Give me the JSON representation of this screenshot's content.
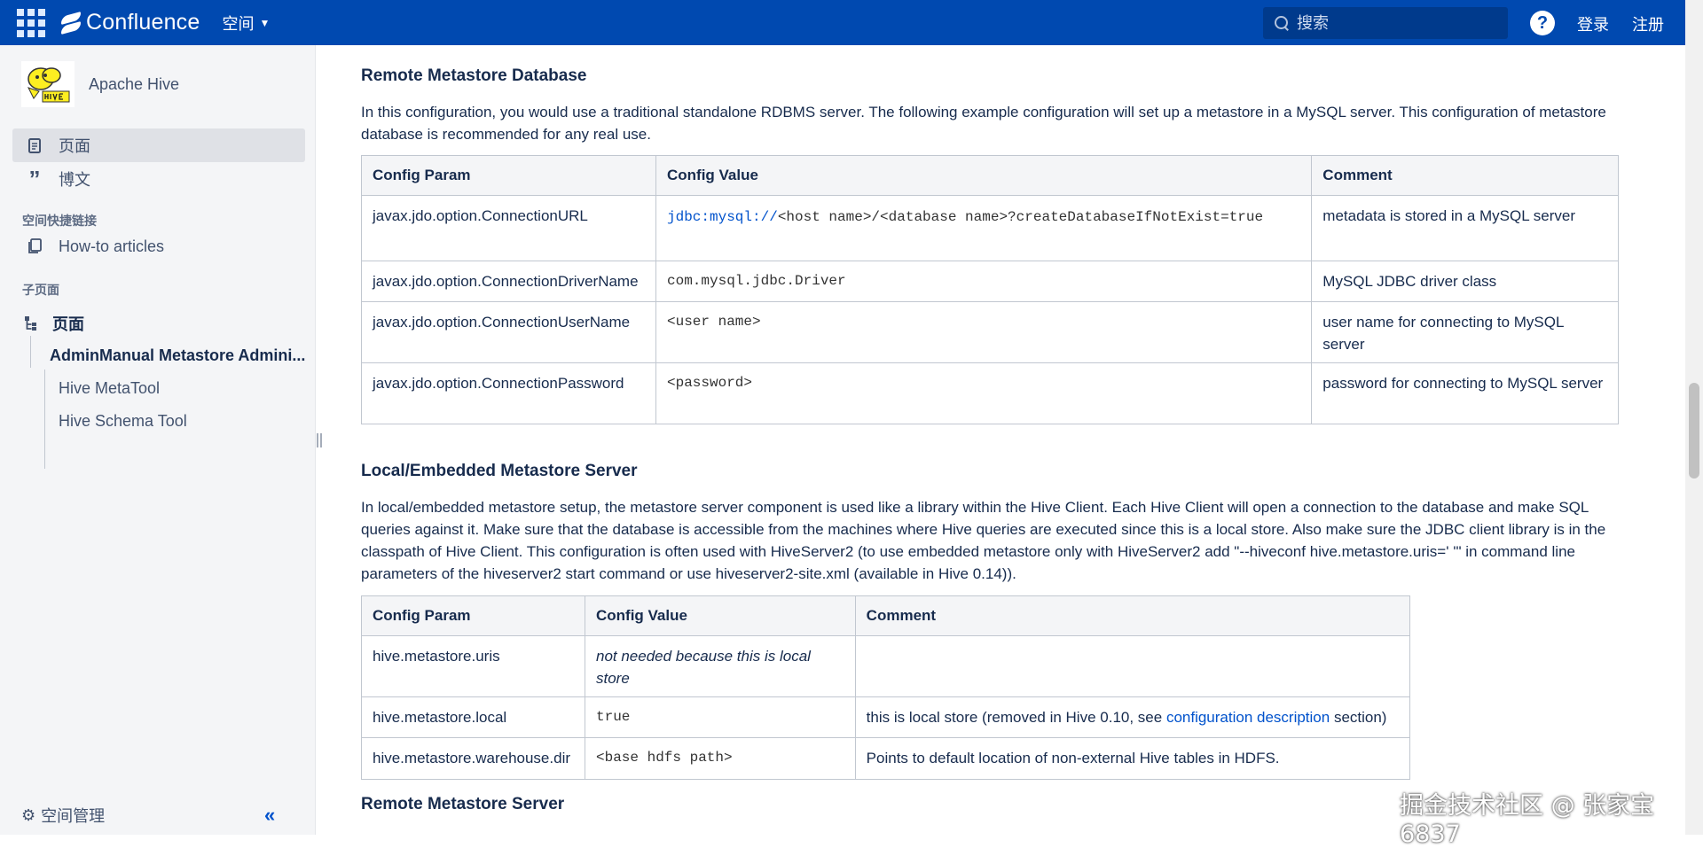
{
  "topbar": {
    "product": "Confluence",
    "space_menu": "空间",
    "search_placeholder": "搜索",
    "help": "?",
    "login": "登录",
    "signup": "注册",
    "brand_color": "#0049b0"
  },
  "sidebar": {
    "space_name": "Apache Hive",
    "nav": [
      {
        "label": "页面",
        "icon": "page-icon",
        "active": true
      },
      {
        "label": "博文",
        "icon": "quote-icon",
        "active": false
      }
    ],
    "shortcuts_title": "空间快捷链接",
    "shortcuts": [
      {
        "label": "How-to articles",
        "icon": "copy-icon"
      }
    ],
    "children_title": "子页面",
    "tree": {
      "root": "页面",
      "parent": "AdminManual Metastore Admini...",
      "children": [
        "Hive MetaTool",
        "Hive Schema Tool"
      ]
    },
    "footer": "空间管理",
    "collapse": "«"
  },
  "content": {
    "section1": {
      "heading": "Remote Metastore Database",
      "text": "In this configuration, you would use a traditional standalone RDBMS server. The following example configuration will set up a metastore in a MySQL server. This configuration of metastore database is recommended for any real use.",
      "table": {
        "headers": [
          "Config Param",
          "Config Value",
          "Comment"
        ],
        "rows": [
          {
            "param": "javax.jdo.option.ConnectionURL",
            "value_link": "jdbc:mysql://",
            "value_rest": "<host name>/<database name>?createDatabaseIfNotExist=true",
            "comment": "metadata is stored in a MySQL server"
          },
          {
            "param": "javax.jdo.option.ConnectionDriverName",
            "value": "com.mysql.jdbc.Driver",
            "comment": "MySQL JDBC driver class"
          },
          {
            "param": "javax.jdo.option.ConnectionUserName",
            "value": "<user name>",
            "comment": "user name for connecting to MySQL server"
          },
          {
            "param": "javax.jdo.option.ConnectionPassword",
            "value": "<password>",
            "comment": "password for connecting to MySQL server"
          }
        ]
      }
    },
    "section2": {
      "heading": "Local/Embedded Metastore Server",
      "text": "In local/embedded metastore setup, the metastore server component is used like a library within the Hive Client. Each Hive Client will open a connection to the database and make SQL queries against it. Make sure that the database is accessible from the machines where Hive queries are executed since this is a local store. Also make sure the JDBC client library is in the classpath of Hive Client. This configuration is often used with HiveServer2 (to use embedded metastore only with HiveServer2 add \"--hiveconf hive.metastore.uris=' '\" in command line parameters of the hiveserver2 start command or use hiveserver2-site.xml (available in Hive 0.14)).",
      "table": {
        "headers": [
          "Config Param",
          "Config Value",
          "Comment"
        ],
        "rows": [
          {
            "param": "hive.metastore.uris",
            "value": "not needed because this is local store",
            "comment": ""
          },
          {
            "param": "hive.metastore.local",
            "value": "true",
            "comment_pre": "this is local store (removed in Hive 0.10, see ",
            "comment_link": "configuration description",
            "comment_post": " section)"
          },
          {
            "param": "hive.metastore.warehouse.dir",
            "value": "<base hdfs path>",
            "comment": "Points to default location of non-external Hive tables in HDFS."
          }
        ]
      }
    },
    "section3": {
      "heading": "Remote Metastore Server"
    }
  },
  "watermark": "掘金技术社区 @ 张家宝6837"
}
